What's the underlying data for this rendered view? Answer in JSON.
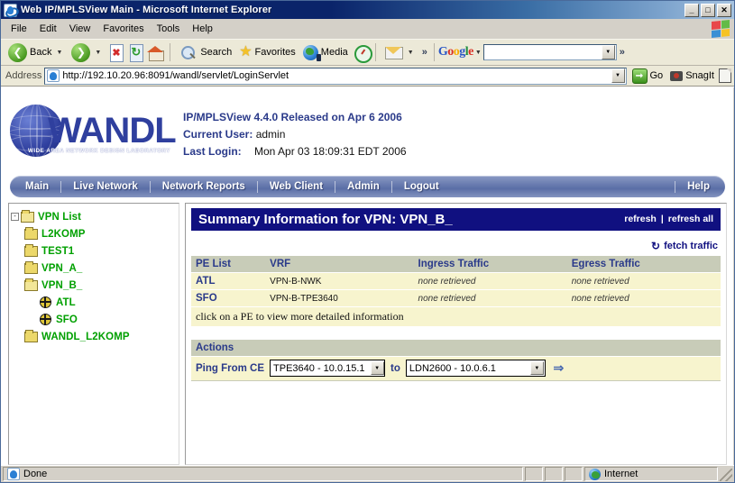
{
  "window": {
    "title": "Web IP/MPLSView Main - Microsoft Internet Explorer",
    "minimize_label": "_",
    "maximize_label": "□",
    "close_label": "✕"
  },
  "menubar": {
    "items": [
      {
        "label": "File"
      },
      {
        "label": "Edit"
      },
      {
        "label": "View"
      },
      {
        "label": "Favorites"
      },
      {
        "label": "Tools"
      },
      {
        "label": "Help"
      }
    ]
  },
  "toolbar": {
    "back_label": "Back",
    "forward_label": "",
    "stop_label": "",
    "refresh_label": "",
    "home_label": "",
    "search_label": "Search",
    "favorites_label": "Favorites",
    "media_label": "Media",
    "history_label": "",
    "mail_label": "",
    "overflow_label": "»",
    "google_label": "Google",
    "google_g1": "G",
    "google_o1": "o",
    "google_o2": "o",
    "google_g2": "g",
    "google_l": "l",
    "google_e": "e",
    "google_search_value": "",
    "google_overflow": "»"
  },
  "address_bar": {
    "label": "Address",
    "url": "http://192.10.20.96:8091/wandl/servlet/LoginServlet",
    "go_label": "Go",
    "snagit_label": "SnagIt"
  },
  "app_header": {
    "logo_text": "WANDL",
    "logo_tagline": "WIDE AREA NETWORK DESIGN LABORATORY",
    "release_line": "IP/MPLSView 4.4.0 Released on Apr 6 2006",
    "current_user_label": "Current User:",
    "current_user_value": "admin",
    "last_login_label": "Last Login:",
    "last_login_value": "Mon Apr 03 18:09:31 EDT 2006"
  },
  "nav": {
    "items": [
      {
        "label": "Main"
      },
      {
        "label": "Live Network"
      },
      {
        "label": "Network Reports"
      },
      {
        "label": "Web Client"
      },
      {
        "label": "Admin"
      },
      {
        "label": "Logout"
      }
    ],
    "help_label": "Help"
  },
  "sidebar": {
    "root": {
      "label": "VPN List",
      "expander": "-"
    },
    "items": [
      {
        "label": "L2KOMP",
        "icon": "folder-icon",
        "level": 1
      },
      {
        "label": "TEST1",
        "icon": "folder-icon",
        "level": 1
      },
      {
        "label": "VPN_A_",
        "icon": "folder-icon",
        "level": 1
      },
      {
        "label": "VPN_B_",
        "icon": "folder-open-icon",
        "level": 1
      },
      {
        "label": "ATL",
        "icon": "pe-node-icon",
        "level": 2
      },
      {
        "label": "SFO",
        "icon": "pe-node-icon",
        "level": 2
      },
      {
        "label": "WANDL_L2KOMP",
        "icon": "folder-icon",
        "level": 1
      }
    ]
  },
  "main": {
    "panel_title": "Summary Information for VPN: VPN_B_",
    "refresh_label": "refresh",
    "refresh_separator": "|",
    "refresh_all_label": "refresh all",
    "fetch_traffic_label": "fetch traffic",
    "fetch_traffic_icon": "↻",
    "table": {
      "headers": [
        "PE List",
        "VRF",
        "Ingress Traffic",
        "Egress Traffic"
      ],
      "rows": [
        {
          "pe": "ATL",
          "vrf": "VPN-B-NWK",
          "ingress": "none retrieved",
          "egress": "none retrieved"
        },
        {
          "pe": "SFO",
          "vrf": "VPN-B-TPE3640",
          "ingress": "none retrieved",
          "egress": "none retrieved"
        }
      ],
      "footer_note": "click on a PE to view more detailed information"
    },
    "actions": {
      "header": "Actions",
      "ping_label": "Ping From CE",
      "from_value": "TPE3640 - 10.0.15.1",
      "to_label": "to",
      "to_value": "LDN2600 - 10.0.6.1",
      "submit_icon": "⇒"
    }
  },
  "statusbar": {
    "status_text": "Done",
    "zone_label": "Internet"
  }
}
